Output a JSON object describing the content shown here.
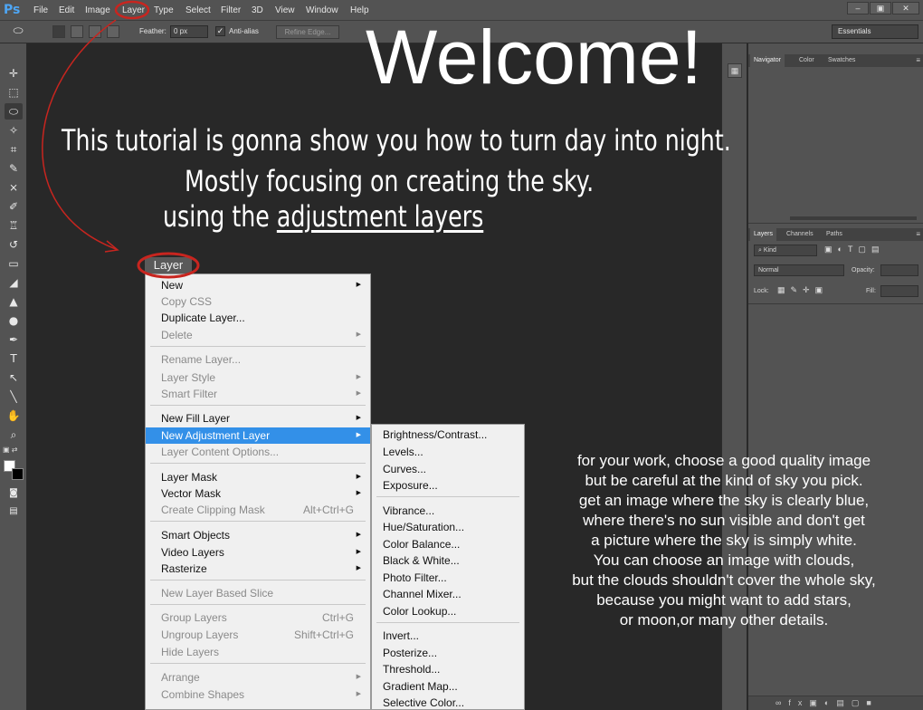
{
  "app": {
    "logo": "Ps"
  },
  "menubar": {
    "items": [
      "File",
      "Edit",
      "Image",
      "Layer",
      "Type",
      "Select",
      "Filter",
      "3D",
      "View",
      "Window",
      "Help"
    ],
    "window_controls": [
      "–",
      "▣",
      "✕"
    ]
  },
  "options": {
    "feather_label": "Feather:",
    "feather_value": "0 px",
    "antialias_label": "Anti-alias",
    "refine_edge": "Refine Edge...",
    "workspace": "Essentials"
  },
  "canvas": {
    "welcome": "Welcome!",
    "intro_line1": "This tutorial is gonna show you how to  turn day into night.",
    "intro_line2": "Mostly  focusing on creating the sky.",
    "intro_line3_prefix": "using the ",
    "intro_line3_link": "adjustment layers",
    "paragraph": [
      "for your work, choose a good quality image",
      "but be careful at the kind of sky you pick.",
      "get  an image where the sky is clearly blue,",
      "where there's no sun visible and don't get",
      "a picture where the sky is simply white.",
      "You can choose an image with clouds,",
      "but  the clouds shouldn't cover the whole sky,",
      "because you might want to add stars,",
      "or moon,or many other details."
    ]
  },
  "layer_menu": {
    "header": "Layer",
    "items": [
      {
        "label": "New",
        "disabled": false,
        "submenu": true
      },
      {
        "label": "Copy CSS",
        "disabled": true
      },
      {
        "label": "Duplicate Layer...",
        "disabled": false
      },
      {
        "label": "Delete",
        "disabled": true,
        "submenu": true
      },
      {
        "label": "Rename Layer...",
        "disabled": true
      },
      {
        "label": "Layer Style",
        "disabled": true,
        "submenu": true
      },
      {
        "label": "Smart Filter",
        "disabled": true,
        "submenu": true
      },
      {
        "label": "New Fill Layer",
        "disabled": false,
        "submenu": true
      },
      {
        "label": "New Adjustment Layer",
        "disabled": false,
        "submenu": true,
        "selected": true
      },
      {
        "label": "Layer Content Options...",
        "disabled": true
      },
      {
        "label": "Layer Mask",
        "disabled": false,
        "submenu": true
      },
      {
        "label": "Vector Mask",
        "disabled": false,
        "submenu": true
      },
      {
        "label": "Create Clipping Mask",
        "disabled": true,
        "shortcut": "Alt+Ctrl+G"
      },
      {
        "label": "Smart Objects",
        "disabled": false,
        "submenu": true
      },
      {
        "label": "Video Layers",
        "disabled": false,
        "submenu": true
      },
      {
        "label": "Rasterize",
        "disabled": false,
        "submenu": true
      },
      {
        "label": "New Layer Based Slice",
        "disabled": true
      },
      {
        "label": "Group Layers",
        "disabled": true,
        "shortcut": "Ctrl+G"
      },
      {
        "label": "Ungroup Layers",
        "disabled": true,
        "shortcut": "Shift+Ctrl+G"
      },
      {
        "label": "Hide Layers",
        "disabled": true
      },
      {
        "label": "Arrange",
        "disabled": true,
        "submenu": true
      },
      {
        "label": "Combine Shapes",
        "disabled": true,
        "submenu": true
      }
    ]
  },
  "adjustment_submenu": {
    "items": [
      "Brightness/Contrast...",
      "Levels...",
      "Curves...",
      "Exposure...",
      "Vibrance...",
      "Hue/Saturation...",
      "Color Balance...",
      "Black & White...",
      "Photo Filter...",
      "Channel Mixer...",
      "Color Lookup...",
      "Invert...",
      "Posterize...",
      "Threshold...",
      "Gradient Map...",
      "Selective Color..."
    ]
  },
  "panels": {
    "top_tabs": [
      "Navigator",
      "Color",
      "Swatches"
    ],
    "layer_tabs": [
      "Layers",
      "Channels",
      "Paths"
    ],
    "kind": "⌕ Kind",
    "blend_mode": "Normal",
    "opacity_label": "Opacity:",
    "lock_label": "Lock:",
    "fill_label": "Fill:"
  },
  "colors": {
    "accent_red": "#c8251f",
    "highlight": "#3390e8"
  }
}
